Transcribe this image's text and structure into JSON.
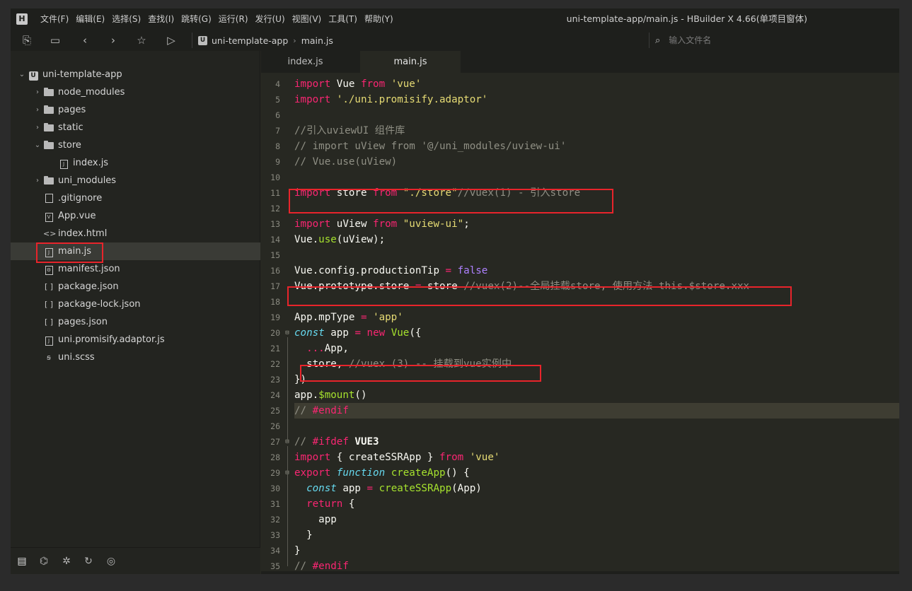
{
  "app": {
    "logo": "H",
    "window_title": "uni-template-app/main.js - HBuilder X 4.66(单项目窗体)"
  },
  "menu": {
    "items": [
      {
        "label": "文件(F)"
      },
      {
        "label": "编辑(E)"
      },
      {
        "label": "选择(S)"
      },
      {
        "label": "查找(I)"
      },
      {
        "label": "跳转(G)"
      },
      {
        "label": "运行(R)"
      },
      {
        "label": "发行(U)"
      },
      {
        "label": "视图(V)"
      },
      {
        "label": "工具(T)"
      },
      {
        "label": "帮助(Y)"
      }
    ]
  },
  "toolbar": {
    "buttons": [
      {
        "name": "new-file-icon",
        "glyph": "⎘"
      },
      {
        "name": "save-icon",
        "glyph": "▭"
      },
      {
        "name": "back-icon",
        "glyph": "‹"
      },
      {
        "name": "forward-icon",
        "glyph": "›"
      },
      {
        "name": "favorite-star-icon",
        "glyph": "☆"
      },
      {
        "name": "run-icon",
        "glyph": "▷"
      }
    ],
    "breadcrumb": {
      "project_icon": "U",
      "project": "uni-template-app",
      "separator": "›",
      "file": "main.js"
    },
    "search": {
      "icon": "search-file-icon",
      "placeholder": "输入文件名"
    }
  },
  "sidebar": {
    "tree": [
      {
        "label": "uni-template-app",
        "type": "project",
        "chev": "⌄",
        "depth": 0
      },
      {
        "label": "node_modules",
        "type": "folder",
        "chev": "›",
        "depth": 1
      },
      {
        "label": "pages",
        "type": "folder",
        "chev": "›",
        "depth": 1
      },
      {
        "label": "static",
        "type": "folder",
        "chev": "›",
        "depth": 1
      },
      {
        "label": "store",
        "type": "folder",
        "chev": "⌄",
        "depth": 1
      },
      {
        "label": "index.js",
        "type": "js",
        "depth": 2
      },
      {
        "label": "uni_modules",
        "type": "folder",
        "chev": "›",
        "depth": 1
      },
      {
        "label": ".gitignore",
        "type": "file",
        "depth": 1
      },
      {
        "label": "App.vue",
        "type": "vue",
        "depth": 1
      },
      {
        "label": "index.html",
        "type": "html",
        "depth": 1
      },
      {
        "label": "main.js",
        "type": "js",
        "depth": 1,
        "selected": true
      },
      {
        "label": "manifest.json",
        "type": "manifest",
        "depth": 1
      },
      {
        "label": "package.json",
        "type": "json",
        "depth": 1
      },
      {
        "label": "package-lock.json",
        "type": "json",
        "depth": 1
      },
      {
        "label": "pages.json",
        "type": "json",
        "depth": 1
      },
      {
        "label": "uni.promisify.adaptor.js",
        "type": "js",
        "depth": 1
      },
      {
        "label": "uni.scss",
        "type": "scss",
        "depth": 1
      }
    ],
    "footer_buttons": [
      {
        "name": "project-manager-icon",
        "glyph": "▤"
      },
      {
        "name": "binoculars-icon",
        "glyph": "⌬"
      },
      {
        "name": "debug-bug-icon",
        "glyph": "✲"
      },
      {
        "name": "source-control-icon",
        "glyph": "↻"
      },
      {
        "name": "plugin-palette-icon",
        "glyph": "◎"
      }
    ]
  },
  "editor": {
    "tabs": [
      {
        "label": "index.js",
        "active": false
      },
      {
        "label": "main.js",
        "active": true
      }
    ],
    "lines": [
      {
        "n": "4",
        "tokens": [
          [
            "kw",
            "import"
          ],
          [
            "plain",
            " Vue "
          ],
          [
            "kw",
            "from"
          ],
          [
            "plain",
            " "
          ],
          [
            "str",
            "'vue'"
          ]
        ]
      },
      {
        "n": "5",
        "tokens": [
          [
            "kw",
            "import"
          ],
          [
            "plain",
            " "
          ],
          [
            "str",
            "'./uni.promisify.adaptor'"
          ]
        ]
      },
      {
        "n": "6",
        "tokens": []
      },
      {
        "n": "7",
        "tokens": [
          [
            "cm",
            "//引入uviewUI 组件库"
          ]
        ]
      },
      {
        "n": "8",
        "tokens": [
          [
            "cm",
            "// import uView from '@/uni_modules/uview-ui'"
          ]
        ]
      },
      {
        "n": "9",
        "tokens": [
          [
            "cm",
            "// Vue.use(uView)"
          ]
        ]
      },
      {
        "n": "10",
        "tokens": []
      },
      {
        "n": "11",
        "tokens": [
          [
            "kw",
            "import"
          ],
          [
            "plain",
            " store "
          ],
          [
            "kw",
            "from"
          ],
          [
            "plain",
            " "
          ],
          [
            "str",
            "\"./store\""
          ],
          [
            "cm",
            "//vuex(1) - 引入store"
          ]
        ]
      },
      {
        "n": "12",
        "tokens": []
      },
      {
        "n": "13",
        "tokens": [
          [
            "kw",
            "import"
          ],
          [
            "plain",
            " uView "
          ],
          [
            "kw",
            "from"
          ],
          [
            "plain",
            " "
          ],
          [
            "str",
            "\"uview-ui\""
          ],
          [
            "plain",
            ";"
          ]
        ]
      },
      {
        "n": "14",
        "tokens": [
          [
            "plain",
            "Vue."
          ],
          [
            "fn",
            "use"
          ],
          [
            "plain",
            "(uView);"
          ]
        ]
      },
      {
        "n": "15",
        "tokens": []
      },
      {
        "n": "16",
        "tokens": [
          [
            "plain",
            "Vue.config.productionTip "
          ],
          [
            "kw",
            "="
          ],
          [
            "plain",
            " "
          ],
          [
            "num",
            "false"
          ]
        ]
      },
      {
        "n": "17",
        "tokens": [
          [
            "plain",
            "Vue.prototype.store "
          ],
          [
            "kw",
            "="
          ],
          [
            "plain",
            " store "
          ],
          [
            "cm",
            "//vuex(2)--全局挂载store, 使用方法 this.$store.xxx"
          ]
        ]
      },
      {
        "n": "18",
        "tokens": []
      },
      {
        "n": "19",
        "tokens": [
          [
            "plain",
            "App.mpType "
          ],
          [
            "kw",
            "="
          ],
          [
            "plain",
            " "
          ],
          [
            "str",
            "'app'"
          ]
        ]
      },
      {
        "n": "20",
        "fold": "⊟",
        "tokens": [
          [
            "it",
            "const"
          ],
          [
            "plain",
            " app "
          ],
          [
            "kw",
            "="
          ],
          [
            "plain",
            " "
          ],
          [
            "kw",
            "new"
          ],
          [
            "plain",
            " "
          ],
          [
            "fn",
            "Vue"
          ],
          [
            "plain",
            "({"
          ]
        ]
      },
      {
        "n": "21",
        "tokens": [
          [
            "plain",
            "  "
          ],
          [
            "kw",
            "..."
          ],
          [
            "plain",
            "App,"
          ]
        ]
      },
      {
        "n": "22",
        "tokens": [
          [
            "plain",
            "  store, "
          ],
          [
            "cm",
            "//vuex (3) -- 挂载到vue实例中"
          ]
        ]
      },
      {
        "n": "23",
        "tokens": [
          [
            "plain",
            "})"
          ]
        ]
      },
      {
        "n": "24",
        "tokens": [
          [
            "plain",
            "app."
          ],
          [
            "fn",
            "$mount"
          ],
          [
            "plain",
            "()"
          ]
        ]
      },
      {
        "n": "25",
        "current": true,
        "tokens": [
          [
            "cm",
            "// "
          ],
          [
            "kw",
            "#endif"
          ]
        ]
      },
      {
        "n": "26",
        "tokens": []
      },
      {
        "n": "27",
        "fold": "⊟",
        "tokens": [
          [
            "cm",
            "// "
          ],
          [
            "kw",
            "#ifdef"
          ],
          [
            "plain",
            " "
          ],
          [
            "bold",
            "VUE3"
          ]
        ]
      },
      {
        "n": "28",
        "tokens": [
          [
            "kw",
            "import"
          ],
          [
            "plain",
            " { createSSRApp } "
          ],
          [
            "kw",
            "from"
          ],
          [
            "plain",
            " "
          ],
          [
            "str",
            "'vue'"
          ]
        ]
      },
      {
        "n": "29",
        "fold": "⊟",
        "tokens": [
          [
            "kw",
            "export"
          ],
          [
            "plain",
            " "
          ],
          [
            "it",
            "function"
          ],
          [
            "plain",
            " "
          ],
          [
            "fn",
            "createApp"
          ],
          [
            "plain",
            "() {"
          ]
        ]
      },
      {
        "n": "30",
        "tokens": [
          [
            "plain",
            "  "
          ],
          [
            "it",
            "const"
          ],
          [
            "plain",
            " app "
          ],
          [
            "kw",
            "="
          ],
          [
            "plain",
            " "
          ],
          [
            "fn",
            "createSSRApp"
          ],
          [
            "plain",
            "(App)"
          ]
        ]
      },
      {
        "n": "31",
        "tokens": [
          [
            "plain",
            "  "
          ],
          [
            "kw",
            "return"
          ],
          [
            "plain",
            " {"
          ]
        ]
      },
      {
        "n": "32",
        "tokens": [
          [
            "plain",
            "    app"
          ]
        ]
      },
      {
        "n": "33",
        "tokens": [
          [
            "plain",
            "  }"
          ]
        ]
      },
      {
        "n": "34",
        "tokens": [
          [
            "plain",
            "}"
          ]
        ]
      },
      {
        "n": "35",
        "tokens": [
          [
            "cm",
            "// "
          ],
          [
            "kw",
            "#endif"
          ]
        ]
      }
    ]
  },
  "colors": {
    "highlight_box": "#e8242b",
    "background": "#272822",
    "keyword": "#f92672",
    "string": "#e6db74",
    "comment": "#8f8f84",
    "function": "#a6e22e"
  }
}
